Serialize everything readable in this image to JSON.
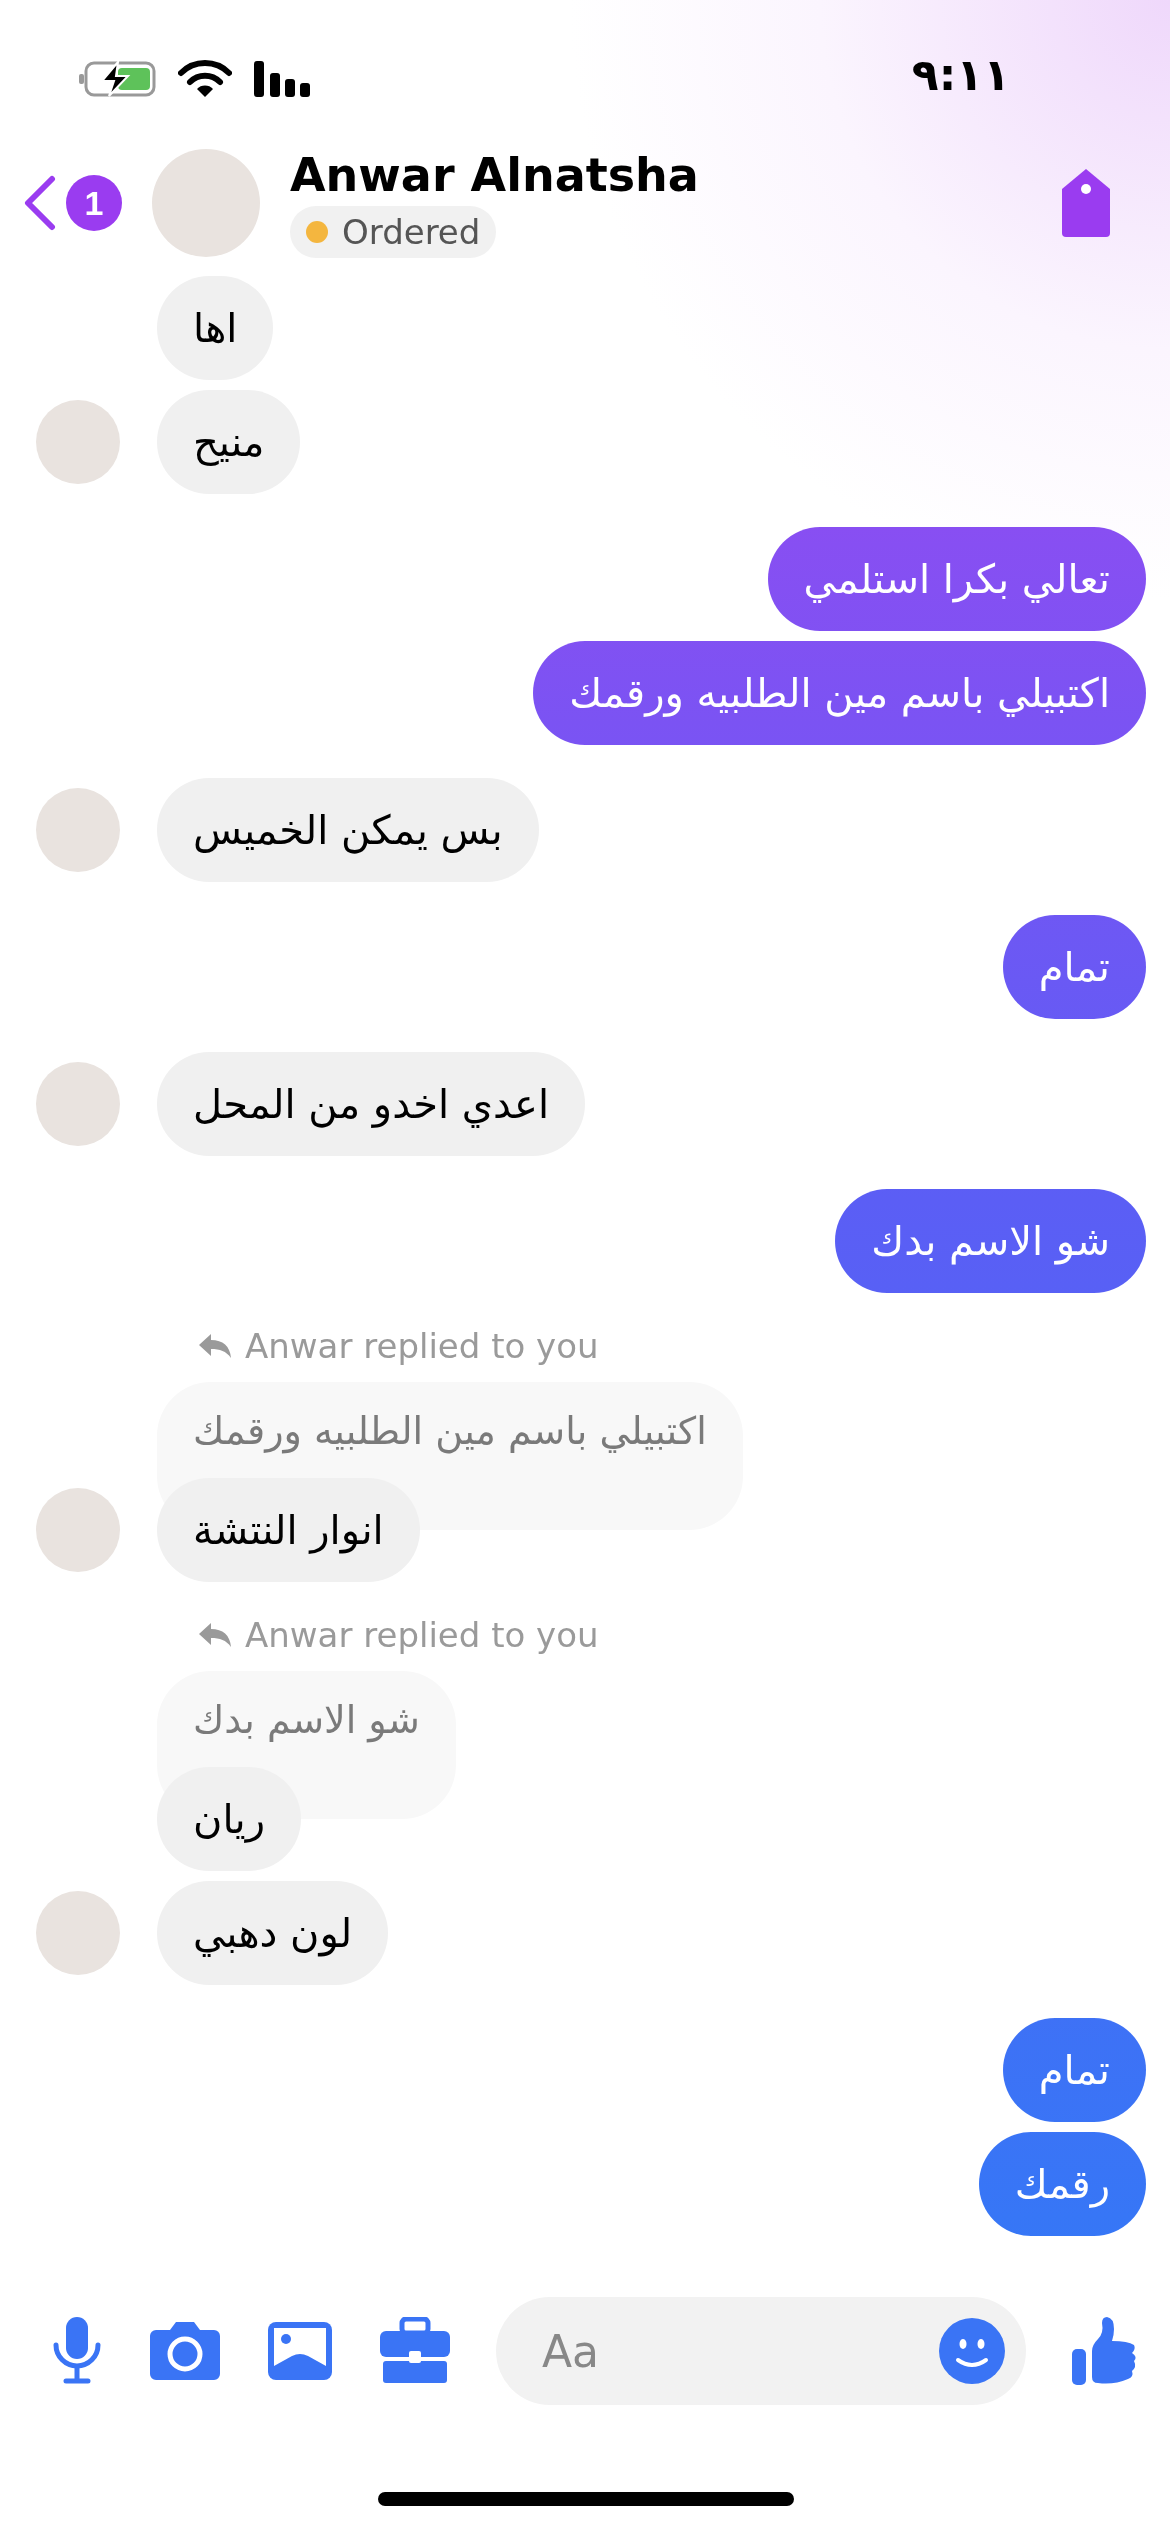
{
  "status_bar": {
    "time": "٩:١١"
  },
  "header": {
    "back_badge": "1",
    "name": "Anwar Alnatsha",
    "status": {
      "label": "Ordered",
      "color": "#f4b63f"
    }
  },
  "messages": [
    {
      "kind": "incoming",
      "text": "اها",
      "avatar": false
    },
    {
      "kind": "incoming",
      "text": "منيح",
      "avatar": true
    },
    {
      "kind": "outgoing",
      "text": "تعالي بكرا استلمي"
    },
    {
      "kind": "outgoing",
      "text": "اكتبيلي باسم مين الطلبيه ورقمك"
    },
    {
      "kind": "incoming",
      "text": "بس يمكن الخميس",
      "avatar": true
    },
    {
      "kind": "outgoing",
      "text": "تمام"
    },
    {
      "kind": "incoming",
      "text": "اعدي اخدو من المحل",
      "avatar": true
    },
    {
      "kind": "outgoing",
      "text": "شو الاسم بدك"
    },
    {
      "kind": "reply",
      "label": "Anwar replied to you",
      "quote": "اكتبيلي باسم مين الطلبيه ورقمك",
      "text": "انوار النتشة",
      "avatar": true
    },
    {
      "kind": "reply",
      "label": "Anwar replied to you",
      "quote": "شو الاسم بدك",
      "text": "ريان",
      "avatar": false
    },
    {
      "kind": "incoming",
      "text": "لون دهبي",
      "avatar": true
    },
    {
      "kind": "outgoing",
      "text": "تمام"
    },
    {
      "kind": "outgoing",
      "text": "رقمك"
    }
  ],
  "composer": {
    "placeholder": "Aa"
  }
}
